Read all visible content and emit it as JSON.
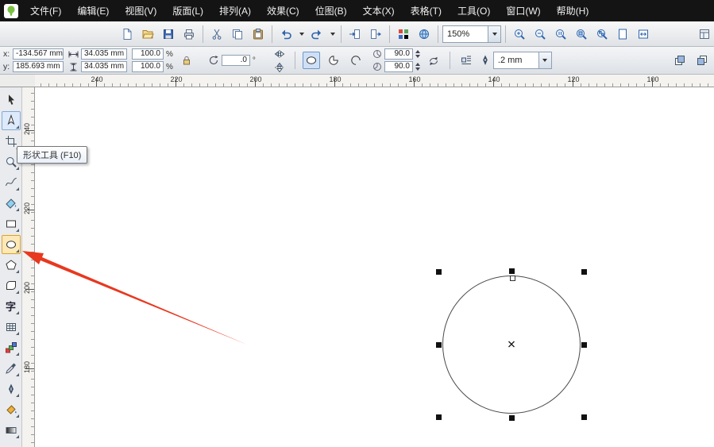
{
  "app": {
    "name": "CorelDRAW"
  },
  "menubar": {
    "items": [
      {
        "label": "文件(F)"
      },
      {
        "label": "编辑(E)"
      },
      {
        "label": "视图(V)"
      },
      {
        "label": "版面(L)"
      },
      {
        "label": "排列(A)"
      },
      {
        "label": "效果(C)"
      },
      {
        "label": "位图(B)"
      },
      {
        "label": "文本(X)"
      },
      {
        "label": "表格(T)"
      },
      {
        "label": "工具(O)"
      },
      {
        "label": "窗口(W)"
      },
      {
        "label": "帮助(H)"
      }
    ]
  },
  "toolbar": {
    "zoom_level": "150%",
    "buttons": [
      "new",
      "open",
      "save",
      "print",
      "cut",
      "copy",
      "paste",
      "undo",
      "undo-more",
      "redo",
      "redo-more",
      "import",
      "export",
      "app-launcher",
      "welcome-screen",
      "zoom-level",
      "zoom-in",
      "zoom-out",
      "zoom-one",
      "zoom-selected",
      "zoom-all",
      "zoom-page",
      "zoom-width",
      "options"
    ]
  },
  "propbar": {
    "x_label": "x:",
    "x_value": "-134.567 mm",
    "y_label": "y:",
    "y_value": "185.693 mm",
    "width_value": "34.035 mm",
    "height_value": "34.035 mm",
    "scale_h": "100.0",
    "scale_v": "100.0",
    "percent": "%",
    "rotation_value": ".0",
    "degree_suffix": "°",
    "start_angle": "90.0",
    "end_angle": "90.0",
    "outline_width": ".2 mm"
  },
  "rulers": {
    "horizontal_labels": [
      "240",
      "220",
      "200",
      "180",
      "160",
      "140",
      "120",
      "100"
    ],
    "vertical_labels": [
      "240",
      "220",
      "200",
      "180"
    ]
  },
  "toolbox": {
    "tools": [
      "pick",
      "shape",
      "crop",
      "zoom",
      "freehand",
      "smart-fill",
      "rectangle",
      "ellipse",
      "polygon",
      "basic-shapes",
      "text",
      "table",
      "blend",
      "eyedropper",
      "outline-pen",
      "fill",
      "interactive-fill"
    ],
    "selected_tool": "ellipse",
    "hovered_tool": "shape",
    "text_tool_glyph": "字"
  },
  "tooltip": {
    "text": "形状工具 (F10)"
  },
  "annotation": {
    "arrow_color": "#e8381f"
  }
}
